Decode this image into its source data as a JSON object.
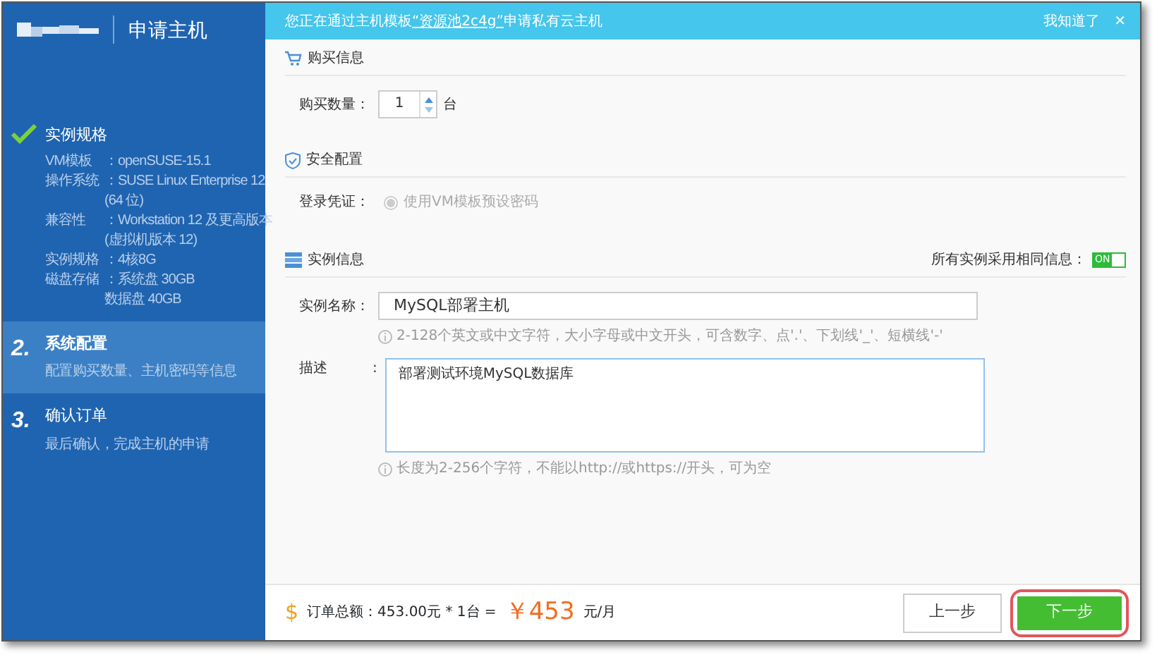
{
  "header": {
    "title": "申请主机"
  },
  "notice": {
    "text_before": "您正在通过主机模板",
    "link": "“资源池2c4g”",
    "text_after": "申请私有云主机",
    "dismiss": "我知道了",
    "close": "✕"
  },
  "steps": [
    {
      "completed": true,
      "selected": false,
      "title": "实例规格",
      "details": [
        {
          "label": "VM模板",
          "value": "：openSUSE-15.1"
        },
        {
          "label": "操作系统",
          "value": "：SUSE Linux Enterprise 12"
        },
        {
          "value": "(64 位)"
        },
        {
          "label": "兼容性",
          "value": "：Workstation 12 及更高版本"
        },
        {
          "value": "(虚拟机版本 12)"
        },
        {
          "label": "实例规格",
          "value": "：4核8G"
        },
        {
          "label": "磁盘存储",
          "value": "：系统盘 30GB"
        },
        {
          "value": "数据盘 40GB"
        }
      ]
    },
    {
      "number": "2.",
      "completed": false,
      "selected": true,
      "title": "系统配置",
      "subtitle": "配置购买数量、主机密码等信息"
    },
    {
      "number": "3.",
      "completed": false,
      "selected": false,
      "title": "确认订单",
      "subtitle": "最后确认，完成主机的申请"
    }
  ],
  "purchase": {
    "title": "购买信息",
    "quantity_label": "购买数量：",
    "quantity": "1",
    "unit": "台"
  },
  "security": {
    "title": "安全配置",
    "login_label": "登录凭证：",
    "option": "使用VM模板预设密码",
    "checked": true,
    "disabled": true
  },
  "instance": {
    "title": "实例信息",
    "same_label": "所有实例采用相同信息：",
    "same_on": true,
    "toggle_text": "ON",
    "name_label": "实例名称：",
    "name_value": "MySQL部署主机",
    "name_hint": "2-128个英文或中文字符，大小字母或中文开头，可含数字、点'.'、下划线'_'、短横线'-'",
    "desc_label": "描述",
    "desc_colon": ":",
    "desc_value": "部署测试环境MySQL数据库",
    "desc_hint": "长度为2-256个字符，不能以http://或https://开头，可为空"
  },
  "footer": {
    "currency_icon": "$",
    "total_label": "订单总额：453.00元 * 1台 =",
    "price": "￥453",
    "price_unit": "元/月",
    "prev": "上一步",
    "next": "下一步",
    "next_highlighted": true
  }
}
